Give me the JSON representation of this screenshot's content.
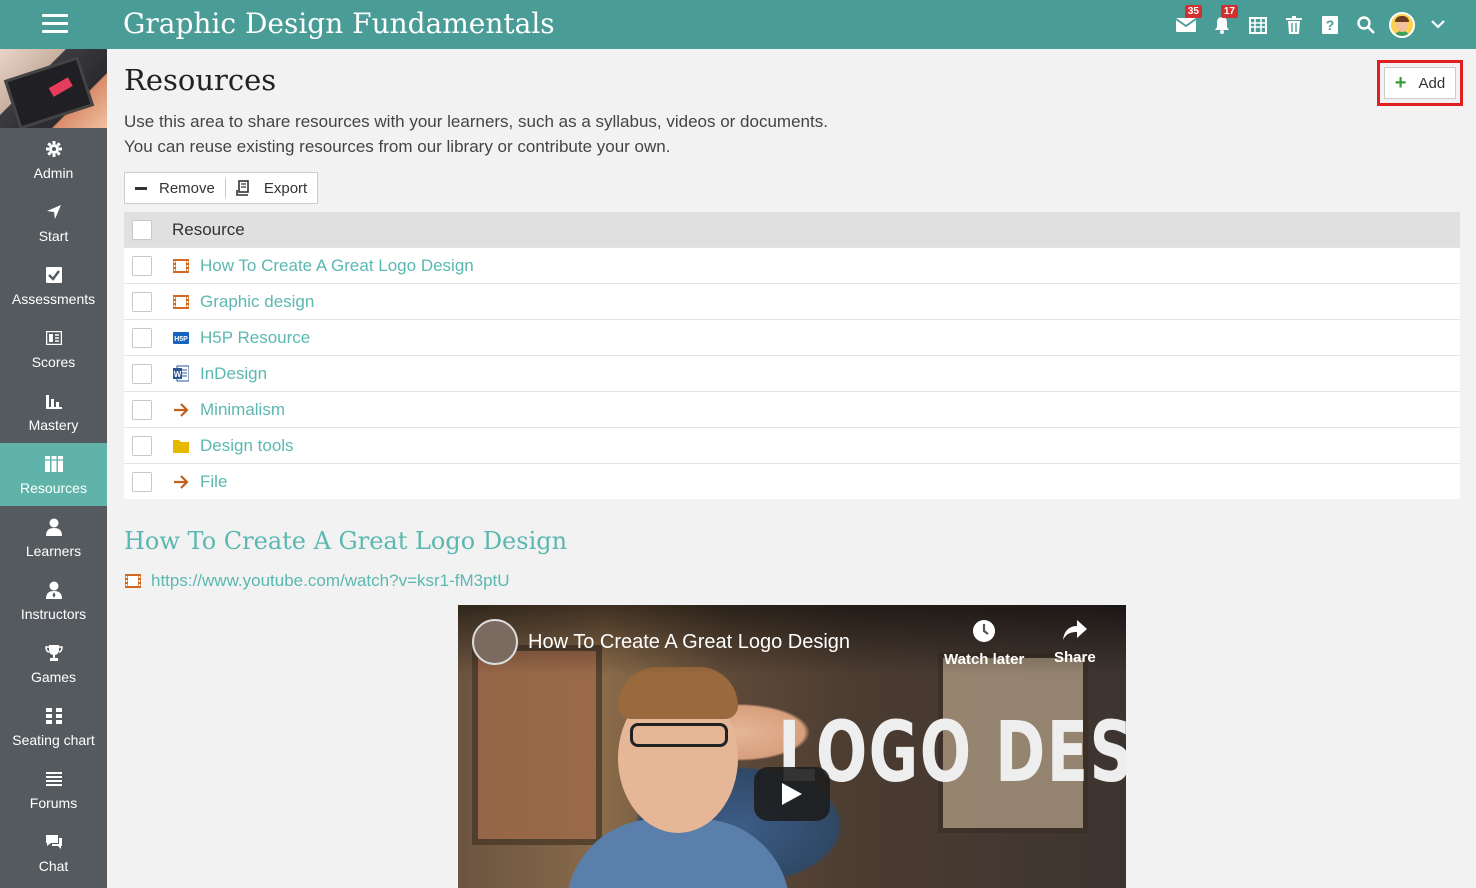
{
  "app": {
    "title": "Graphic Design Fundamentals"
  },
  "topbar": {
    "messages_badge": "35",
    "notifications_badge": "17"
  },
  "sidebar": {
    "items": [
      {
        "label": "Admin",
        "icon": "gear-icon"
      },
      {
        "label": "Start",
        "icon": "location-arrow-icon"
      },
      {
        "label": "Assessments",
        "icon": "checkbox-icon"
      },
      {
        "label": "Scores",
        "icon": "gradebook-icon"
      },
      {
        "label": "Mastery",
        "icon": "bar-chart-icon"
      },
      {
        "label": "Resources",
        "icon": "books-icon"
      },
      {
        "label": "Learners",
        "icon": "user-icon"
      },
      {
        "label": "Instructors",
        "icon": "instructor-icon"
      },
      {
        "label": "Games",
        "icon": "trophy-icon"
      },
      {
        "label": "Seating chart",
        "icon": "seating-icon"
      },
      {
        "label": "Forums",
        "icon": "list-icon"
      },
      {
        "label": "Chat",
        "icon": "chat-icon"
      }
    ],
    "active": "Resources"
  },
  "page": {
    "title": "Resources",
    "description_line1": "Use this area to share resources with your learners, such as a syllabus, videos or documents.",
    "description_line2": "You can reuse existing resources from our library or contribute your own.",
    "add_label": "Add"
  },
  "toolbar": {
    "remove_label": "Remove",
    "export_label": "Export"
  },
  "table": {
    "header": "Resource",
    "rows": [
      {
        "name": "How To Create A Great Logo Design",
        "type": "video-icon"
      },
      {
        "name": "Graphic design",
        "type": "video-icon"
      },
      {
        "name": "H5P Resource",
        "type": "h5p-icon"
      },
      {
        "name": "InDesign",
        "type": "word-doc-icon"
      },
      {
        "name": "Minimalism",
        "type": "link-arrow-icon"
      },
      {
        "name": "Design tools",
        "type": "folder-icon"
      },
      {
        "name": "File",
        "type": "link-arrow-icon"
      }
    ]
  },
  "detail": {
    "title": "How To Create A Great Logo Design",
    "url": "https://www.youtube.com/watch?v=ksr1-fM3ptU",
    "video": {
      "title": "How To Create A Great Logo Design",
      "watch_later": "Watch later",
      "share": "Share",
      "overlay_text": "LOGO DESIGN"
    }
  },
  "colors": {
    "topbar": "#4a9c97",
    "sidebar": "#555a5f",
    "sidebar_active": "#5fb3a8",
    "link": "#5bb8b0",
    "highlight": "#e02020"
  }
}
